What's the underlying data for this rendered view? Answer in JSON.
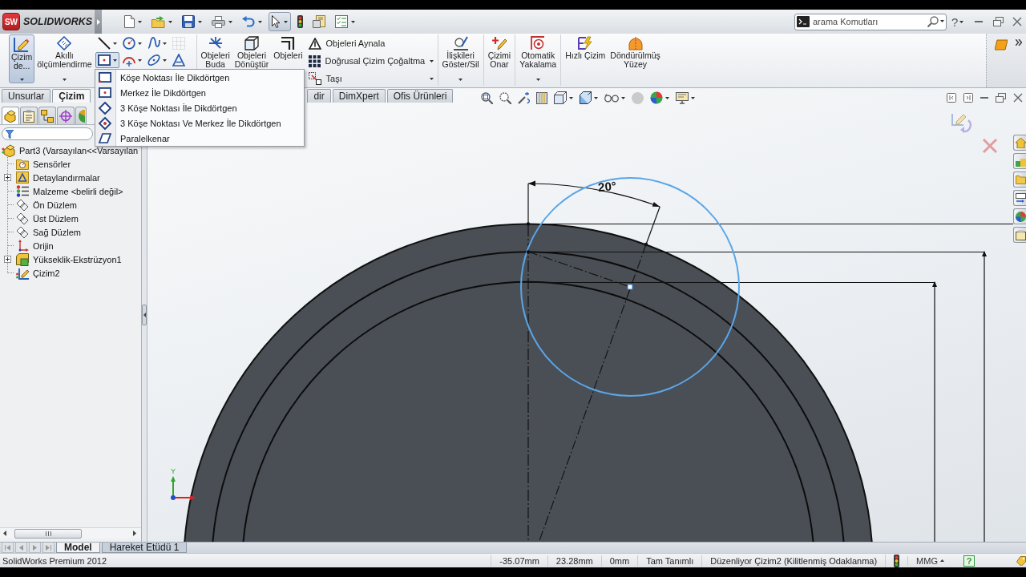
{
  "title_bar": {
    "logo_mark": "SW",
    "app_name": "SOLIDWORKS",
    "quick_access": [
      {
        "pressed": false
      },
      {
        "pressed": false
      },
      {
        "pressed": false
      },
      {
        "pressed": false
      },
      {
        "pressed": false
      },
      {
        "pressed": true
      },
      {
        "pressed": false
      },
      {
        "pressed": false
      },
      {
        "pressed": false
      }
    ],
    "search": {
      "placeholder": "arama Komutları"
    },
    "help": "?"
  },
  "ribbon": {
    "groups": [
      {
        "commands": [
          {
            "kind": "large",
            "label": "Çizim\nde...",
            "pressed": true,
            "dropdown": true
          },
          {
            "kind": "large",
            "label": "Akıllı\nölçümlendirme",
            "pressed": false,
            "dropdown": true
          },
          {
            "kind": "sketch_tools"
          }
        ]
      },
      {
        "commands": [
          {
            "kind": "large",
            "label": "Objeleri\nBuda",
            "pressed": false,
            "dropdown": false
          },
          {
            "kind": "large",
            "label": "Objeleri\nDönüştür",
            "pressed": false,
            "dropdown": false
          },
          {
            "kind": "large",
            "label": "Objeleri",
            "pressed": false,
            "dropdown": false
          },
          {
            "kind": "stack",
            "items": [
              {
                "label": "Objeleri Aynala",
                "dropdown": false
              },
              {
                "label": "Doğrusal Çizim Çoğaltma",
                "dropdown": true
              },
              {
                "label": "Taşı",
                "dropdown": true
              }
            ]
          }
        ]
      },
      {
        "commands": [
          {
            "kind": "large",
            "label": "İlişkileri\nGöster/Sil",
            "pressed": false,
            "dropdown": true
          }
        ]
      },
      {
        "commands": [
          {
            "kind": "large",
            "label": "Çizimi\nOnar",
            "pressed": false,
            "dropdown": false
          }
        ]
      },
      {
        "commands": [
          {
            "kind": "large",
            "label": "Otomatik\nYakalama",
            "pressed": false,
            "dropdown": true
          }
        ]
      },
      {
        "commands": [
          {
            "kind": "large",
            "label": "Hızlı Çizim",
            "pressed": false,
            "dropdown": false
          },
          {
            "kind": "large",
            "label": "Döndürülmüş\nYüzey",
            "pressed": false,
            "dropdown": false
          }
        ]
      }
    ]
  },
  "tabs": [
    {
      "label": "Unsurlar",
      "kind": "full",
      "selected": false
    },
    {
      "label": "Çizim",
      "kind": "full",
      "selected": true
    },
    {
      "label": "dir",
      "kind": "partial",
      "selected": false
    },
    {
      "label": "DimXpert",
      "kind": "full",
      "selected": false
    },
    {
      "label": "Ofis Ürünleri",
      "kind": "full",
      "selected": false
    }
  ],
  "shape_menu": {
    "open": true,
    "items": [
      "Köşe Noktası İle Dikdörtgen",
      "Merkez İle Dikdörtgen",
      "3 Köşe Noktası İle Dikdörtgen",
      "3 Köşe Noktası Ve Merkez İle Dikdörtgen",
      "Paralelkenar"
    ]
  },
  "feature_manager": {
    "panel_tabs": [
      {
        "selected": true
      },
      {
        "selected": false
      },
      {
        "selected": false
      },
      {
        "selected": false
      },
      {
        "selected": false
      }
    ],
    "tree": [
      {
        "label": "Part3 (Varsayılan<<Varsayılan",
        "kind": "part",
        "children": [
          {
            "label": "Sensörler",
            "kind": "sensors"
          },
          {
            "label": "Detaylandırmalar",
            "kind": "annotations",
            "expanded": false
          },
          {
            "label": "Malzeme <belirli değil>",
            "kind": "material"
          },
          {
            "label": "Ön Düzlem",
            "kind": "plane"
          },
          {
            "label": "Üst Düzlem",
            "kind": "plane"
          },
          {
            "label": "Sağ Düzlem",
            "kind": "plane"
          },
          {
            "label": "Orijin",
            "kind": "origin"
          },
          {
            "label": "Yükseklik-Ekstrüzyon1",
            "kind": "feature",
            "expanded": false
          },
          {
            "label": "Çizim2",
            "kind": "sketch"
          }
        ]
      }
    ]
  },
  "graphics": {
    "dimension_label": "20°",
    "triad_label": "Y"
  },
  "bottom_tabs": [
    {
      "label": "Model",
      "selected": true
    },
    {
      "label": "Hareket Etüdü 1",
      "selected": false
    }
  ],
  "status_bar": {
    "product": "SolidWorks Premium 2012",
    "cells": [
      "-35.07mm",
      "23.28mm",
      "0mm",
      "Tam Tanımlı",
      "Düzenliyor Çizim2 (Kilitlenmiş Odaklanma)"
    ],
    "units": "MMG",
    "help": "?"
  }
}
